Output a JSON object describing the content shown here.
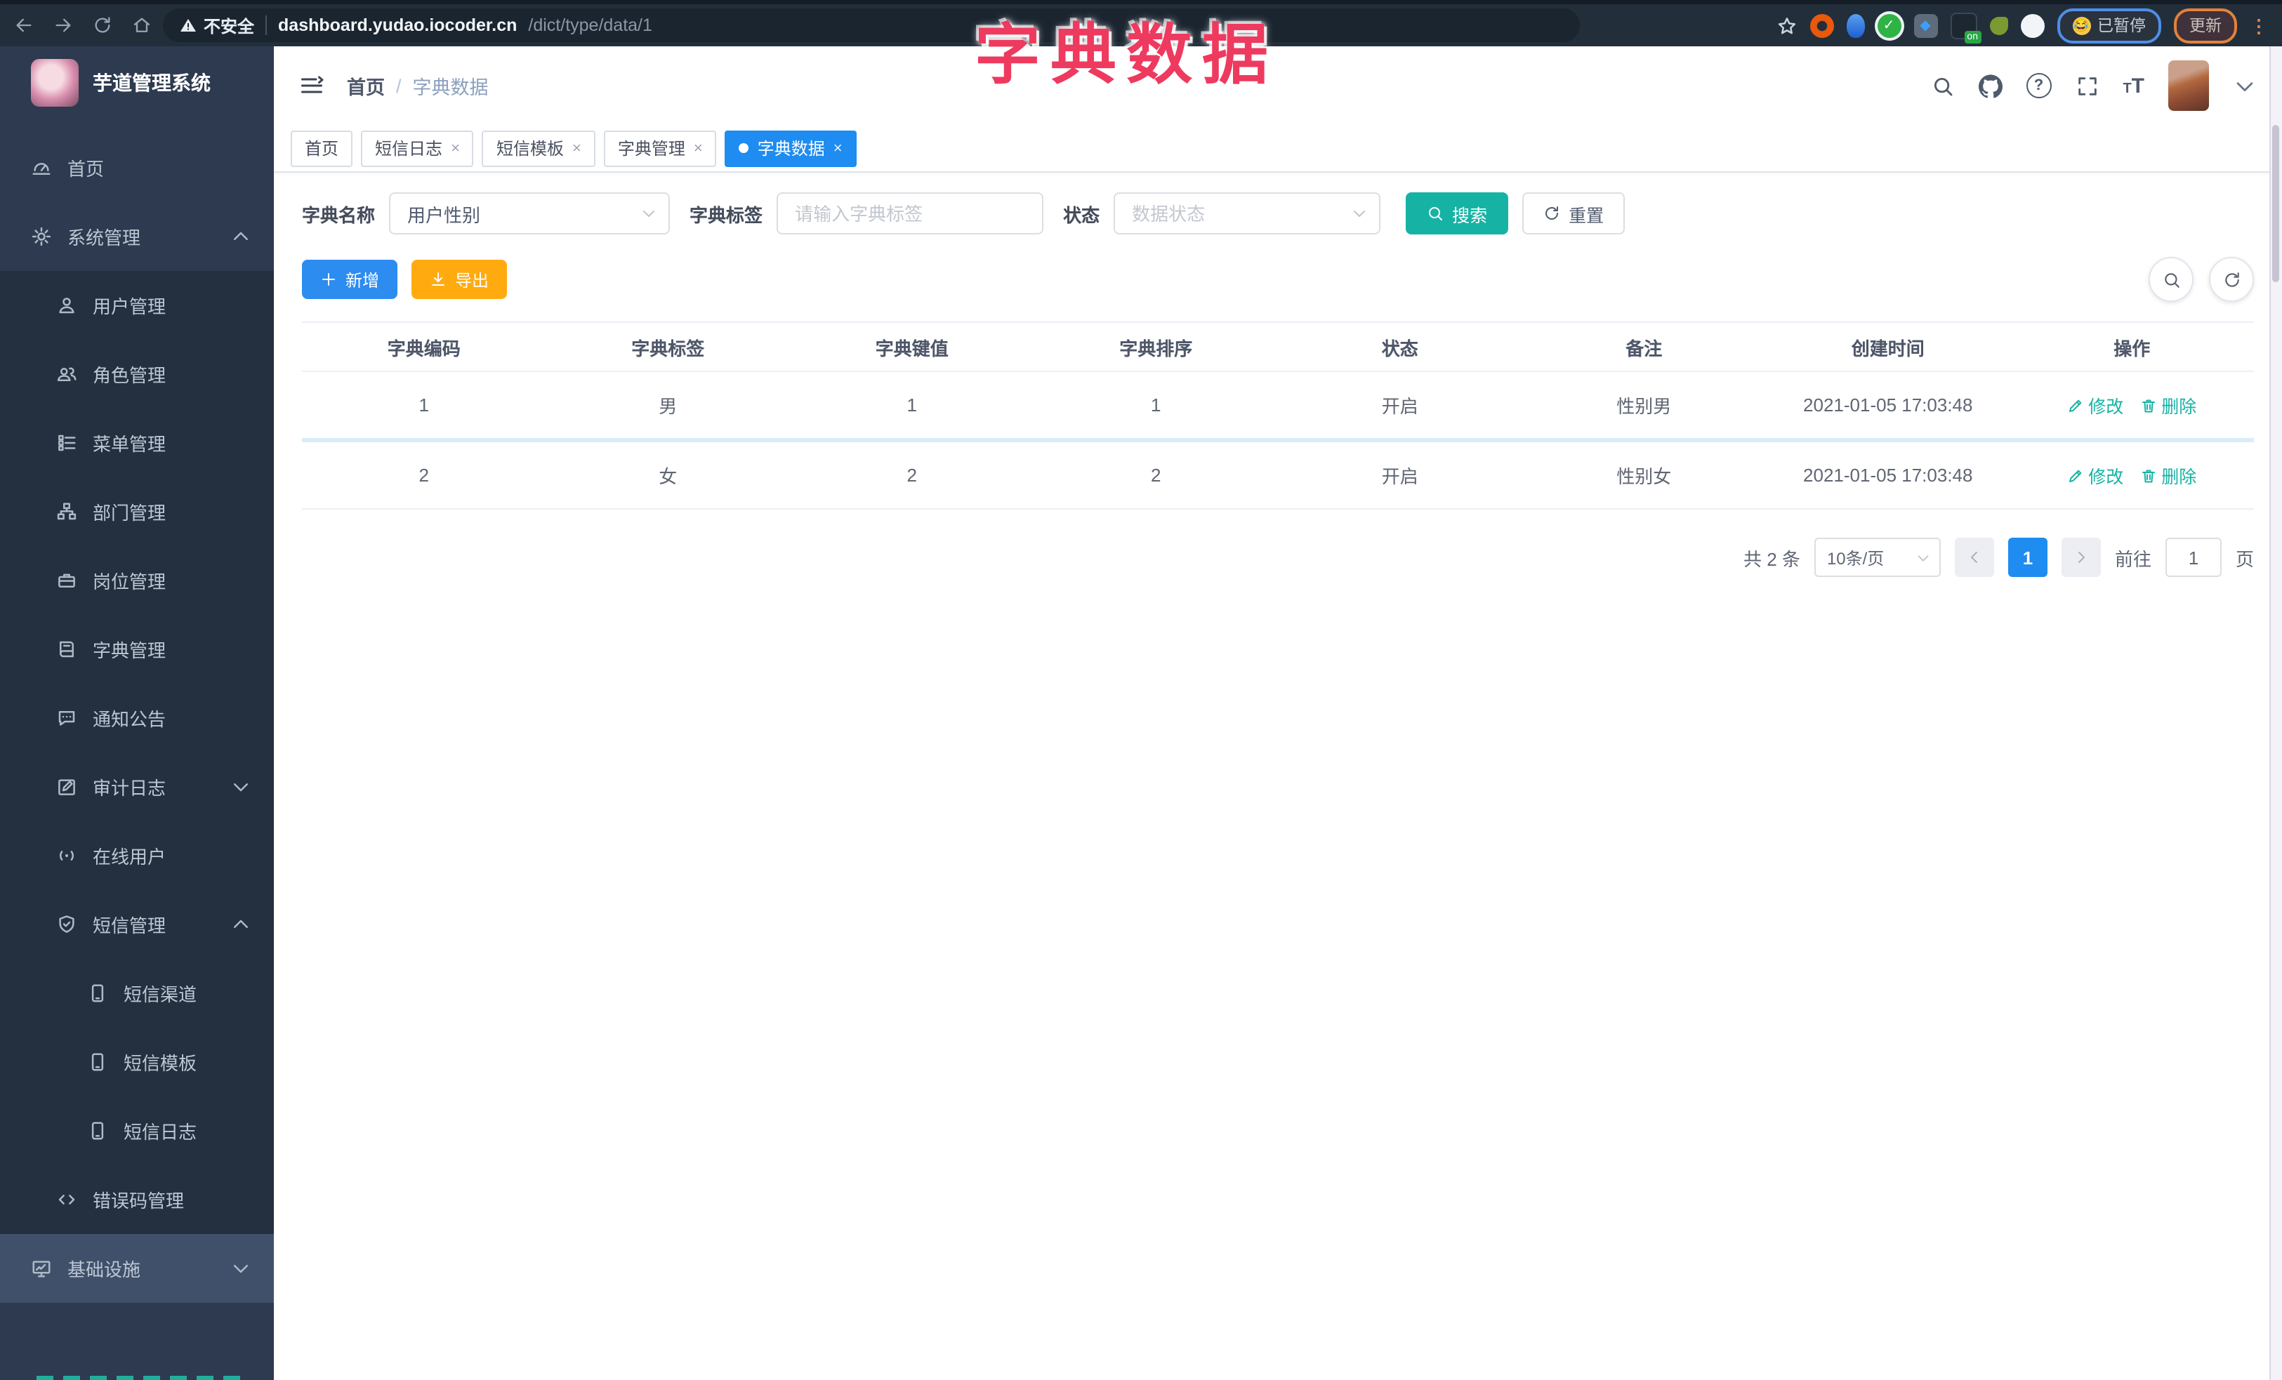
{
  "browser": {
    "security_label": "不安全",
    "url_host": "dashboard.yudao.iocoder.cn",
    "url_path": "/dict/type/data/1",
    "ext_on_badge": "on",
    "paused_label": "已暂停",
    "paused_emoji": "😂",
    "update_label": "更新",
    "menu_dots": "⋮"
  },
  "annotation": {
    "title": "字典数据"
  },
  "sidebar": {
    "app_title": "芋道管理系统",
    "items": [
      {
        "label": "首页",
        "icon": "dashboard-icon",
        "level": 0,
        "caret": ""
      },
      {
        "label": "系统管理",
        "icon": "gear-icon",
        "level": 0,
        "caret": "up"
      },
      {
        "label": "用户管理",
        "icon": "user-icon",
        "level": 1,
        "caret": ""
      },
      {
        "label": "角色管理",
        "icon": "users-icon",
        "level": 1,
        "caret": ""
      },
      {
        "label": "菜单管理",
        "icon": "menu-list-icon",
        "level": 1,
        "caret": ""
      },
      {
        "label": "部门管理",
        "icon": "org-tree-icon",
        "level": 1,
        "caret": ""
      },
      {
        "label": "岗位管理",
        "icon": "briefcase-icon",
        "level": 1,
        "caret": ""
      },
      {
        "label": "字典管理",
        "icon": "book-icon",
        "level": 1,
        "caret": ""
      },
      {
        "label": "通知公告",
        "icon": "megaphone-icon",
        "level": 1,
        "caret": ""
      },
      {
        "label": "审计日志",
        "icon": "edit-icon",
        "level": 1,
        "caret": "down"
      },
      {
        "label": "在线用户",
        "icon": "online-icon",
        "level": 1,
        "caret": ""
      },
      {
        "label": "短信管理",
        "icon": "shield-icon",
        "level": 1,
        "caret": "up"
      },
      {
        "label": "短信渠道",
        "icon": "phone-icon",
        "level": 2,
        "caret": ""
      },
      {
        "label": "短信模板",
        "icon": "phone-icon",
        "level": 2,
        "caret": ""
      },
      {
        "label": "短信日志",
        "icon": "phone-icon",
        "level": 2,
        "caret": ""
      },
      {
        "label": "错误码管理",
        "icon": "code-icon",
        "level": 1,
        "caret": ""
      },
      {
        "label": "基础设施",
        "icon": "monitor-icon",
        "level": 0,
        "caret": "down",
        "highlight": true
      }
    ]
  },
  "header": {
    "breadcrumb_home": "首页",
    "breadcrumb_sep": "/",
    "breadcrumb_current": "字典数据"
  },
  "tabs": [
    {
      "label": "首页",
      "closable": false,
      "active": false
    },
    {
      "label": "短信日志",
      "closable": true,
      "active": false
    },
    {
      "label": "短信模板",
      "closable": true,
      "active": false
    },
    {
      "label": "字典管理",
      "closable": true,
      "active": false
    },
    {
      "label": "字典数据",
      "closable": true,
      "active": true
    }
  ],
  "filters": {
    "dict_name_label": "字典名称",
    "dict_name_value": "用户性别",
    "dict_label_label": "字典标签",
    "dict_label_placeholder": "请输入字典标签",
    "status_label": "状态",
    "status_placeholder": "数据状态",
    "search_label": "搜索",
    "reset_label": "重置"
  },
  "toolbar": {
    "add_label": "新增",
    "export_label": "导出"
  },
  "table": {
    "headers": [
      "字典编码",
      "字典标签",
      "字典键值",
      "字典排序",
      "状态",
      "备注",
      "创建时间",
      "操作"
    ],
    "edit_label": "修改",
    "delete_label": "删除",
    "rows": [
      {
        "code": "1",
        "label": "男",
        "value": "1",
        "sort": "1",
        "status": "开启",
        "remark": "性别男",
        "created": "2021-01-05 17:03:48"
      },
      {
        "code": "2",
        "label": "女",
        "value": "2",
        "sort": "2",
        "status": "开启",
        "remark": "性别女",
        "created": "2021-01-05 17:03:48"
      }
    ]
  },
  "pagination": {
    "total_text": "共 2 条",
    "page_size": "10条/页",
    "page": "1",
    "goto_label": "前往",
    "goto_value": "1",
    "unit_label": "页"
  },
  "colors": {
    "teal": "#16b3a4",
    "blue": "#1e8cf0",
    "orange": "#ffab10",
    "annotation_pink": "#ee3a5f",
    "sidebar_bg": "#2d3a4f"
  }
}
